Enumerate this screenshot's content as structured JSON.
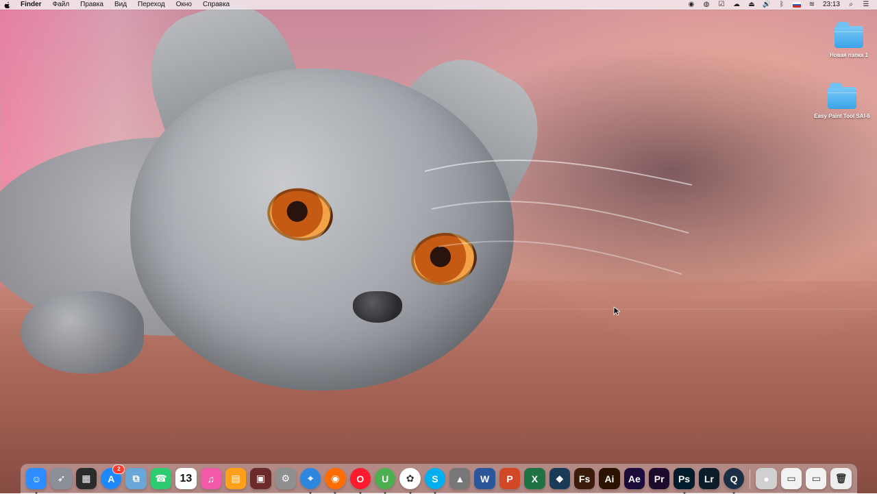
{
  "menubar": {
    "apple_icon": "apple-icon",
    "app_name": "Finder",
    "menus": [
      "Файл",
      "Правка",
      "Вид",
      "Переход",
      "Окно",
      "Справка"
    ],
    "status_icons": [
      "screen-record-icon",
      "app-status-icon",
      "check-icon",
      "cloud-icon",
      "eject-icon",
      "volume-icon",
      "bluetooth-icon",
      "keyboard-layout-flag-icon",
      "wifi-icon"
    ],
    "time": "23:13",
    "right_icons": [
      "search-icon",
      "notification-center-icon"
    ]
  },
  "desktop": {
    "icons": [
      {
        "label": "Новая папка 1",
        "icon": "folder-icon"
      },
      {
        "label": "Easy Paint Tool SAI-6",
        "icon": "folder-icon"
      }
    ]
  },
  "dock": {
    "items": [
      {
        "name": "Finder",
        "icon": "finder-icon",
        "running": true,
        "bg": "#2d8cff"
      },
      {
        "name": "Launchpad",
        "icon": "rocket-icon",
        "running": false,
        "bg": "#8a8f98"
      },
      {
        "name": "Mission Control",
        "icon": "mission-control-icon",
        "running": false,
        "bg": "#2b2b2b"
      },
      {
        "name": "App Store",
        "icon": "app-store-icon",
        "running": false,
        "bg": "#1e88ff",
        "badge": "2"
      },
      {
        "name": "Preview",
        "icon": "preview-icon",
        "running": false,
        "bg": "#6aa6d8"
      },
      {
        "name": "FaceTime",
        "icon": "facetime-icon",
        "running": false,
        "bg": "#2ecc71"
      },
      {
        "name": "Calendar",
        "icon": "calendar-icon",
        "running": false,
        "bg": "#ffffff",
        "text": "13"
      },
      {
        "name": "iTunes",
        "icon": "itunes-icon",
        "running": false,
        "bg": "#f05aa7"
      },
      {
        "name": "iBooks",
        "icon": "ibooks-icon",
        "running": false,
        "bg": "#ff9f1a"
      },
      {
        "name": "Photo Booth",
        "icon": "photo-booth-icon",
        "running": false,
        "bg": "#6b2b2b"
      },
      {
        "name": "System Preferences",
        "icon": "gear-icon",
        "running": false,
        "bg": "#8f8f8f"
      },
      {
        "name": "Safari",
        "icon": "safari-icon",
        "running": true,
        "bg": "#2e86de"
      },
      {
        "name": "Firefox",
        "icon": "firefox-icon",
        "running": true,
        "bg": "#ff6d00"
      },
      {
        "name": "Opera",
        "icon": "opera-icon",
        "running": true,
        "bg": "#ff1b2d"
      },
      {
        "name": "uTorrent",
        "icon": "utorrent-icon",
        "running": true,
        "bg": "#4caf50",
        "text": "U"
      },
      {
        "name": "Photos",
        "icon": "photos-icon",
        "running": true,
        "bg": "#ffffff"
      },
      {
        "name": "Skype",
        "icon": "skype-icon",
        "running": true,
        "bg": "#00aff0",
        "text": "S"
      },
      {
        "name": "App",
        "icon": "triangle-logo-icon",
        "running": false,
        "bg": "#777777"
      },
      {
        "name": "Word",
        "icon": "word-icon",
        "running": false,
        "bg": "#2b579a",
        "text": "W"
      },
      {
        "name": "PowerPoint",
        "icon": "powerpoint-icon",
        "running": false,
        "bg": "#d24726",
        "text": "P"
      },
      {
        "name": "Excel",
        "icon": "excel-icon",
        "running": false,
        "bg": "#1f7244",
        "text": "X"
      },
      {
        "name": "App",
        "icon": "sketch-icon",
        "running": false,
        "bg": "#1b3a57"
      },
      {
        "name": "Adobe Fuse",
        "icon": "fs-icon",
        "running": false,
        "bg": "#3b1c0a",
        "text": "Fs"
      },
      {
        "name": "Adobe Illustrator",
        "icon": "ai-icon",
        "running": false,
        "bg": "#2b1300",
        "text": "Ai"
      },
      {
        "name": "After Effects",
        "icon": "ae-icon",
        "running": false,
        "bg": "#1a0b3b",
        "text": "Ae"
      },
      {
        "name": "Premiere Pro",
        "icon": "pr-icon",
        "running": false,
        "bg": "#1c0b2b",
        "text": "Pr"
      },
      {
        "name": "Photoshop",
        "icon": "ps-icon",
        "running": true,
        "bg": "#001b2b",
        "text": "Ps"
      },
      {
        "name": "Lightroom",
        "icon": "lr-icon",
        "running": false,
        "bg": "#0c1c2b",
        "text": "Lr"
      },
      {
        "name": "QuickTime",
        "icon": "quicktime-icon",
        "running": true,
        "bg": "#1a2f45"
      },
      {
        "name": "Screen Recorder",
        "icon": "record-icon",
        "running": false,
        "bg": "#d0d0d0"
      },
      {
        "name": "Doc 1",
        "icon": "document-icon",
        "running": false,
        "bg": "#f2f2f2"
      },
      {
        "name": "Doc 2",
        "icon": "document-icon",
        "running": false,
        "bg": "#f2f2f2"
      },
      {
        "name": "Trash",
        "icon": "trash-icon",
        "running": false,
        "bg": "#eeeeee"
      }
    ]
  },
  "colors": {
    "menubar_bg": "#f4eef2",
    "dock_bg": "#f5ebf0",
    "folder_blue": "#3aa4e9"
  }
}
